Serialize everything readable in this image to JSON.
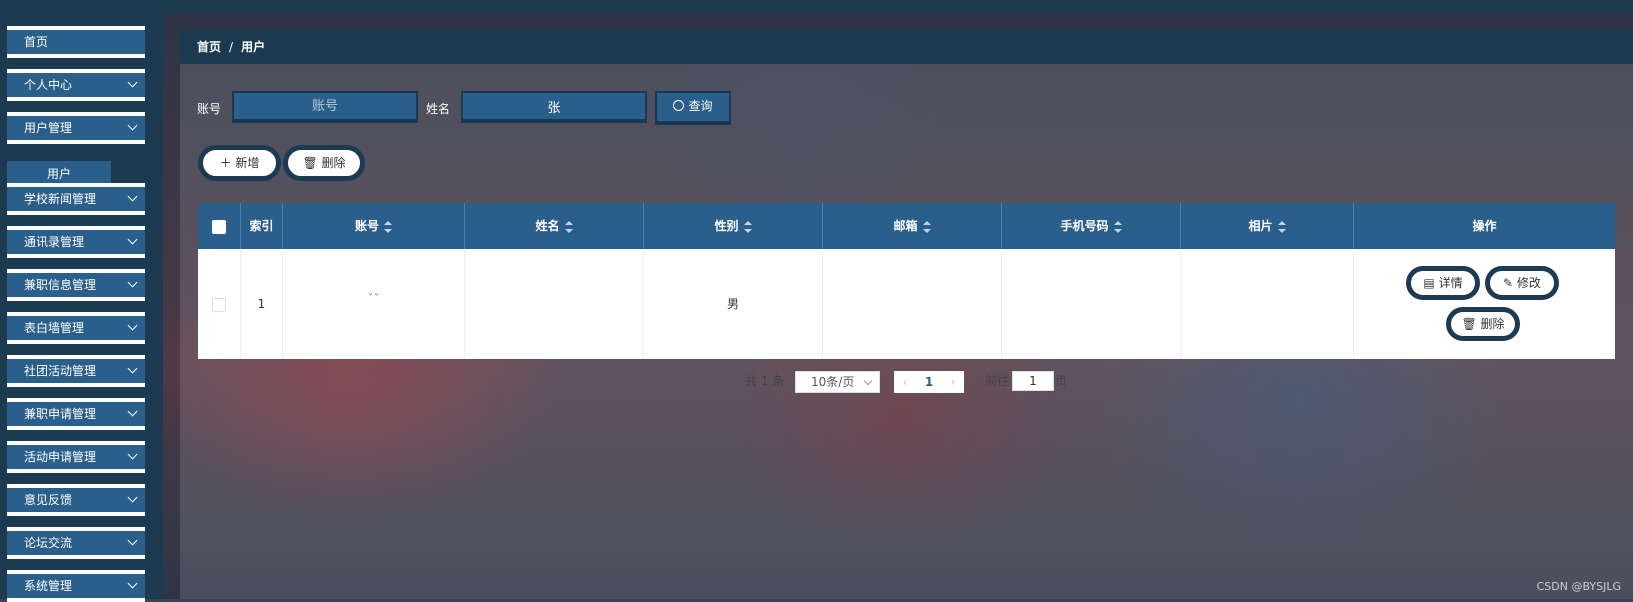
{
  "sidebar": {
    "items": [
      {
        "label": "首页",
        "has_children": false
      },
      {
        "label": "个人中心",
        "has_children": true
      },
      {
        "label": "用户管理",
        "has_children": true
      },
      {
        "label": "学校新闻管理",
        "has_children": true
      },
      {
        "label": "通讯录管理",
        "has_children": true
      },
      {
        "label": "兼职信息管理",
        "has_children": true
      },
      {
        "label": "表白墙管理",
        "has_children": true
      },
      {
        "label": "社团活动管理",
        "has_children": true
      },
      {
        "label": "兼职申请管理",
        "has_children": true
      },
      {
        "label": "活动申请管理",
        "has_children": true
      },
      {
        "label": "意见反馈",
        "has_children": true
      },
      {
        "label": "论坛交流",
        "has_children": true
      },
      {
        "label": "系统管理",
        "has_children": true
      }
    ],
    "active_submenu": "用户"
  },
  "breadcrumb": {
    "home": "首页",
    "separator": "/",
    "current": "用户"
  },
  "search": {
    "account_label": "账号",
    "account_placeholder": "账号",
    "account_value": "",
    "name_label": "姓名",
    "name_value": "张",
    "query_label": "查询"
  },
  "actions": {
    "add_label": "新增",
    "delete_label": "删除"
  },
  "table": {
    "headers": [
      "索引",
      "账号",
      "姓名",
      "性别",
      "邮箱",
      "手机号码",
      "相片",
      "操作"
    ],
    "rows": [
      {
        "index": "1",
        "account": "ˇˇ",
        "name": "",
        "gender": "男",
        "email": "",
        "phone": "",
        "photo": ""
      }
    ],
    "row_actions": {
      "detail": "详情",
      "edit": "修改",
      "delete": "删除"
    }
  },
  "pagination": {
    "total": "共 1 条",
    "page_size": "10条/页",
    "current_page": "1",
    "goto_prefix": "前往",
    "goto_value": "1",
    "goto_suffix": "页"
  },
  "watermark": "CSDN @BYSJLG",
  "colors": {
    "primary": "#2b5f8b",
    "dark": "#1b3a4f"
  }
}
